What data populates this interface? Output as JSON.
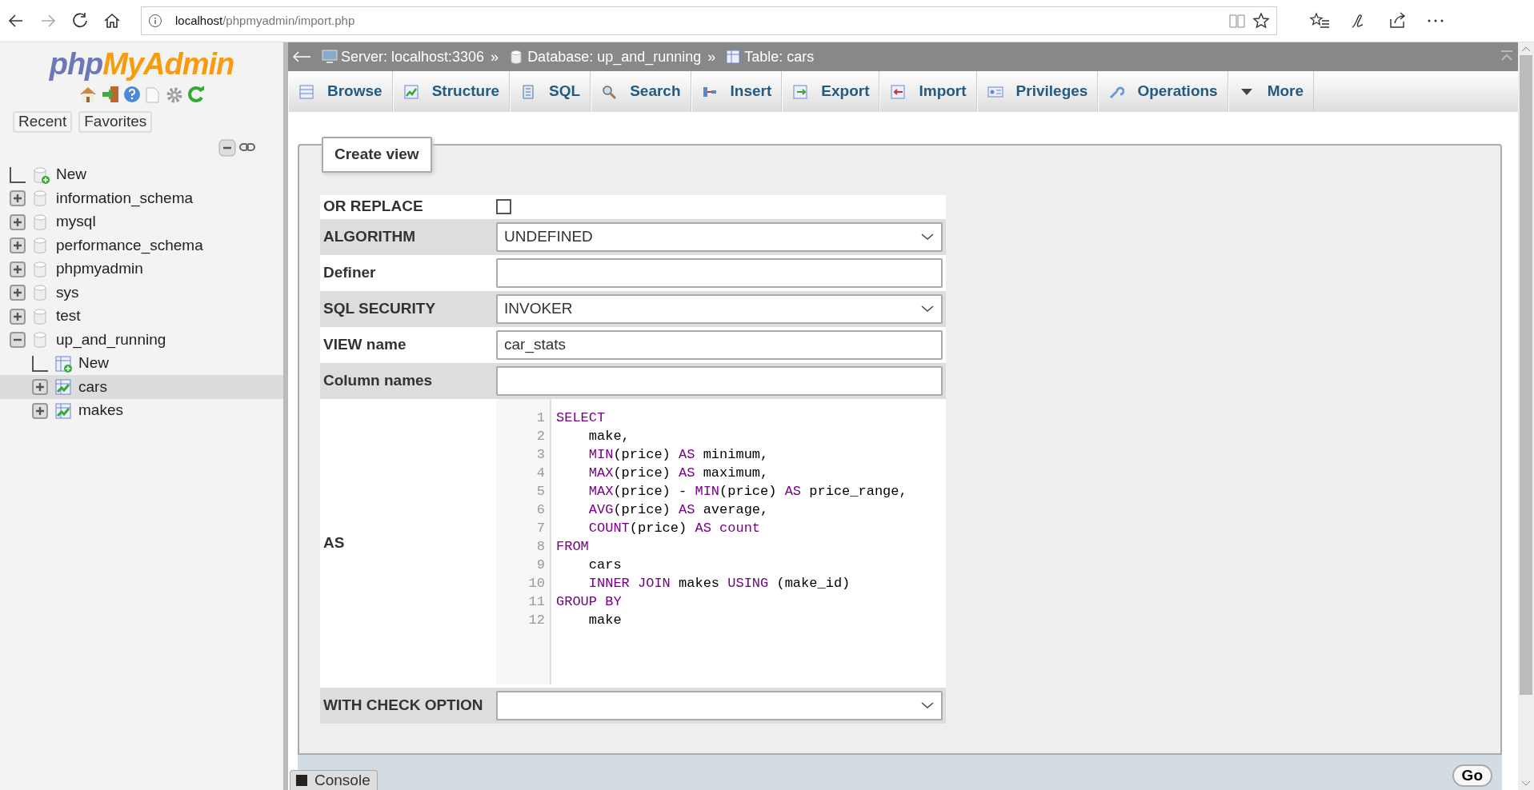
{
  "browser": {
    "url_host": "localhost",
    "url_path": "/phpmyadmin/import.php",
    "forward_disabled": true
  },
  "sidebar": {
    "logo": {
      "php": "php",
      "myadmin": "MyAdmin"
    },
    "tabs": [
      {
        "label": "Recent"
      },
      {
        "label": "Favorites"
      }
    ],
    "tree": [
      {
        "label": "New",
        "kind": "new"
      },
      {
        "label": "information_schema",
        "kind": "database",
        "expanded": false,
        "selected": false
      },
      {
        "label": "mysql",
        "kind": "database",
        "expanded": false,
        "selected": false
      },
      {
        "label": "performance_schema",
        "kind": "database",
        "expanded": false,
        "selected": false
      },
      {
        "label": "phpmyadmin",
        "kind": "database",
        "expanded": false,
        "selected": false
      },
      {
        "label": "sys",
        "kind": "database",
        "expanded": false,
        "selected": false
      },
      {
        "label": "test",
        "kind": "database",
        "expanded": false,
        "selected": false
      },
      {
        "label": "up_and_running",
        "kind": "database",
        "expanded": true,
        "selected": false,
        "children": [
          {
            "label": "New",
            "kind": "new_table"
          },
          {
            "label": "cars",
            "kind": "table",
            "expanded": false,
            "selected": true
          },
          {
            "label": "makes",
            "kind": "table",
            "expanded": false,
            "selected": false
          }
        ]
      }
    ]
  },
  "breadcrumb": [
    {
      "kind": "server",
      "label": "Server: localhost:3306",
      "separator": "»"
    },
    {
      "kind": "database",
      "label": "Database: up_and_running",
      "separator": "»"
    },
    {
      "kind": "table",
      "label": "Table: cars"
    }
  ],
  "tabs": [
    {
      "kind": "browse",
      "label": "Browse",
      "selected": false
    },
    {
      "kind": "structure",
      "label": "Structure",
      "selected": false
    },
    {
      "kind": "sql",
      "label": "SQL",
      "selected": false
    },
    {
      "kind": "search",
      "label": "Search",
      "selected": false
    },
    {
      "kind": "insert",
      "label": "Insert",
      "selected": false
    },
    {
      "kind": "export",
      "label": "Export",
      "selected": false
    },
    {
      "kind": "import",
      "label": "Import",
      "selected": false
    },
    {
      "kind": "privileges",
      "label": "Privileges",
      "selected": false
    },
    {
      "kind": "operations",
      "label": "Operations",
      "selected": false
    },
    {
      "kind": "more",
      "label": "More",
      "selected": false
    }
  ],
  "form": {
    "legend": "Create view",
    "rows": [
      {
        "kind": "checkbox",
        "label": "OR REPLACE",
        "checked": false
      },
      {
        "kind": "select",
        "label": "ALGORITHM",
        "value": "UNDEFINED"
      },
      {
        "kind": "text",
        "label": "Definer"
      },
      {
        "kind": "select",
        "label": "SQL SECURITY",
        "value": "INVOKER"
      },
      {
        "kind": "text",
        "label": "VIEW name",
        "value": "car_stats"
      },
      {
        "kind": "text",
        "label": "Column names"
      },
      {
        "kind": "code",
        "label": "AS",
        "lines": [
          {
            "number": "1",
            "tokens": [
              {
                "kind": "keyword",
                "text": "SELECT"
              }
            ]
          },
          {
            "number": "2",
            "indented": true,
            "tokens": [
              {
                "kind": "plain",
                "text": "make,"
              }
            ]
          },
          {
            "number": "3",
            "indented": true,
            "tokens": [
              {
                "kind": "keyword",
                "text": "MIN"
              },
              {
                "kind": "plain",
                "text": "(price) "
              },
              {
                "kind": "keyword",
                "text": "AS"
              },
              {
                "kind": "plain",
                "text": " minimum,"
              }
            ]
          },
          {
            "number": "4",
            "indented": true,
            "tokens": [
              {
                "kind": "keyword",
                "text": "MAX"
              },
              {
                "kind": "plain",
                "text": "(price) "
              },
              {
                "kind": "keyword",
                "text": "AS"
              },
              {
                "kind": "plain",
                "text": " maximum,"
              }
            ]
          },
          {
            "number": "5",
            "indented": true,
            "tokens": [
              {
                "kind": "keyword",
                "text": "MAX"
              },
              {
                "kind": "plain",
                "text": "(price) - "
              },
              {
                "kind": "keyword",
                "text": "MIN"
              },
              {
                "kind": "plain",
                "text": "(price) "
              },
              {
                "kind": "keyword",
                "text": "AS"
              },
              {
                "kind": "plain",
                "text": " price_range,"
              }
            ]
          },
          {
            "number": "6",
            "indented": true,
            "tokens": [
              {
                "kind": "keyword",
                "text": "AVG"
              },
              {
                "kind": "plain",
                "text": "(price) "
              },
              {
                "kind": "keyword",
                "text": "AS"
              },
              {
                "kind": "plain",
                "text": " average,"
              }
            ]
          },
          {
            "number": "7",
            "indented": true,
            "tokens": [
              {
                "kind": "keyword",
                "text": "COUNT"
              },
              {
                "kind": "plain",
                "text": "(price) "
              },
              {
                "kind": "keyword",
                "text": "AS count"
              }
            ]
          },
          {
            "number": "8",
            "tokens": [
              {
                "kind": "keyword",
                "text": "FROM"
              }
            ]
          },
          {
            "number": "9",
            "indented": true,
            "tokens": [
              {
                "kind": "plain",
                "text": "cars"
              }
            ]
          },
          {
            "number": "10",
            "indented": true,
            "tokens": [
              {
                "kind": "keyword",
                "text": "INNER JOIN"
              },
              {
                "kind": "plain",
                "text": " makes "
              },
              {
                "kind": "keyword",
                "text": "USING"
              },
              {
                "kind": "plain",
                "text": " (make_id)"
              }
            ]
          },
          {
            "number": "11",
            "tokens": [
              {
                "kind": "keyword",
                "text": "GROUP BY"
              }
            ]
          },
          {
            "number": "12",
            "indented": true,
            "tokens": [
              {
                "kind": "plain",
                "text": "make"
              }
            ]
          }
        ]
      },
      {
        "kind": "select",
        "label": "WITH CHECK OPTION"
      }
    ]
  },
  "footer": {
    "button": "Go"
  },
  "console": {
    "label": "Console"
  }
}
